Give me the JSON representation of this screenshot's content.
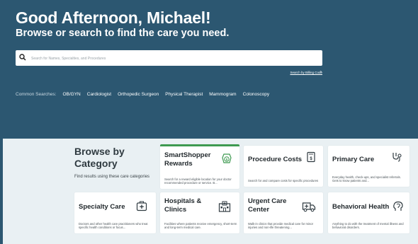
{
  "hero": {
    "greeting": "Good Afternoon, Michael!",
    "subtitle": "Browse or search to find the care you need.",
    "search_placeholder": "Search for Names, Specialties, and Procedures",
    "billing_link": "Search by Billing Code",
    "common_label": "Common Searches:",
    "common_searches": [
      "OB/GYN",
      "Cardiologist",
      "Orthopedic Surgeon",
      "Physical Therapist",
      "Mammogram",
      "Colonoscopy"
    ]
  },
  "browse": {
    "title": "Browse by Category",
    "subtitle": "Find results using these care categories"
  },
  "cards": [
    {
      "title": "SmartShopper Rewards",
      "desc": "Search for a reward eligible location for your doctor recommended procedure or service. B...",
      "icon": "dollar-sign-icon"
    },
    {
      "title": "Procedure Costs",
      "desc": "Search for and compare costs for specific procedures",
      "icon": "bill-icon"
    },
    {
      "title": "Primary Care",
      "desc": "Everyday health, check-ups, and specialist referrals. Gets to know patients and...",
      "icon": "stethoscope-icon"
    },
    {
      "title": "Specialty Care",
      "desc": "Doctors and other health care practitioners who treat specific health conditions or focus...",
      "icon": "medical-kit-icon"
    },
    {
      "title": "Hospitals & Clinics",
      "desc": "Facilities where patients receive emergency, short-term and long-term medical care.",
      "icon": "hospital-icon"
    },
    {
      "title": "Urgent Care Center",
      "desc": "Walk-in clinics that provide medical care for minor injuries and non-life threatening...",
      "icon": "ambulance-icon"
    },
    {
      "title": "Behavioral Health",
      "desc": "Anything to do with the treatment of mental illness and behavioral disorders.",
      "icon": "brain-icon"
    }
  ],
  "colors": {
    "hero_bg": "#2c5771",
    "page_bg": "#e9f0f3",
    "accent_green": "#3e9a51"
  }
}
